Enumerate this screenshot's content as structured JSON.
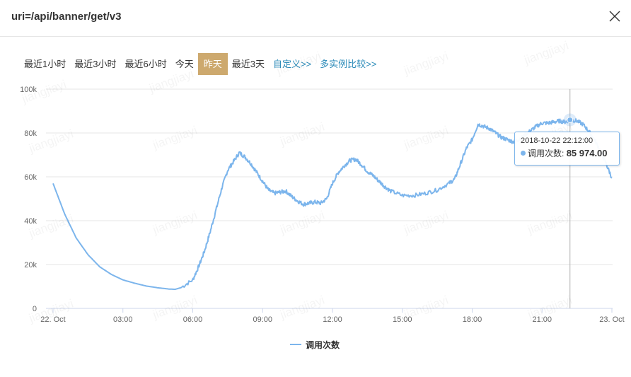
{
  "header": {
    "title": "uri=/api/banner/get/v3"
  },
  "toolbar": {
    "buttons": [
      "最近1小时",
      "最近3小时",
      "最近6小时",
      "今天",
      "昨天",
      "最近3天"
    ],
    "active_index": 4,
    "links": [
      "自定义>>",
      "多实例比较>>"
    ]
  },
  "watermark_text": "jiangjiayi",
  "colors": {
    "series": "#7cb5ec",
    "active_button": "#cda96e",
    "link": "#2a8ab8"
  },
  "tooltip": {
    "date": "2018-10-22 22:12:00",
    "label": "调用次数:",
    "value": "85 974.00"
  },
  "chart_data": {
    "type": "line",
    "xlabel": "",
    "ylabel": "",
    "ylim": [
      0,
      100000
    ],
    "y_ticks": [
      0,
      20000,
      40000,
      60000,
      80000,
      100000
    ],
    "y_tick_labels": [
      "0",
      "20k",
      "40k",
      "60k",
      "80k",
      "100k"
    ],
    "x_range_hours": [
      0,
      24
    ],
    "x_ticks_hours": [
      0,
      3,
      6,
      9,
      12,
      15,
      18,
      21,
      24
    ],
    "x_tick_labels": [
      "22. Oct",
      "03:00",
      "06:00",
      "09:00",
      "12:00",
      "15:00",
      "18:00",
      "21:00",
      "23. Oct"
    ],
    "legend_position": "bottom-center",
    "grid": true,
    "series": [
      {
        "name": "调用次数",
        "x_hours": [
          0.0,
          0.5,
          1.0,
          1.5,
          2.0,
          2.5,
          3.0,
          3.5,
          4.0,
          4.5,
          5.0,
          5.25,
          5.5,
          6.0,
          6.25,
          6.5,
          6.75,
          7.0,
          7.25,
          7.5,
          7.75,
          8.0,
          8.25,
          8.5,
          8.75,
          9.0,
          9.25,
          9.5,
          9.75,
          10.0,
          10.25,
          10.5,
          10.75,
          11.0,
          11.25,
          11.5,
          11.75,
          12.0,
          12.25,
          12.5,
          12.75,
          13.0,
          13.25,
          13.5,
          13.75,
          14.0,
          14.25,
          14.5,
          15.0,
          15.5,
          16.0,
          16.5,
          17.0,
          17.25,
          17.5,
          17.75,
          18.0,
          18.25,
          18.5,
          18.75,
          19.0,
          19.25,
          19.5,
          19.75,
          20.0,
          20.25,
          20.5,
          20.75,
          21.0,
          21.25,
          21.5,
          21.75,
          22.0,
          22.2,
          22.5,
          22.75,
          23.0,
          23.25,
          23.5,
          23.75,
          24.0
        ],
        "values": [
          57000,
          43000,
          32000,
          24500,
          19000,
          15500,
          13000,
          11500,
          10200,
          9400,
          8800,
          8700,
          9500,
          13000,
          19000,
          26000,
          35000,
          45000,
          55000,
          63000,
          67000,
          71000,
          69000,
          66000,
          62000,
          58000,
          54000,
          52500,
          53000,
          53500,
          51000,
          49000,
          47500,
          48000,
          48500,
          48000,
          50000,
          57000,
          62000,
          65000,
          67500,
          68000,
          65500,
          62500,
          60500,
          58000,
          55500,
          53500,
          51500,
          51500,
          52500,
          54000,
          57000,
          59000,
          66000,
          73000,
          77000,
          84000,
          83000,
          82000,
          80000,
          78000,
          77000,
          76000,
          77000,
          79000,
          81000,
          83000,
          84500,
          84500,
          85000,
          85500,
          85000,
          85974,
          85500,
          84000,
          81000,
          77000,
          72000,
          66000,
          59500
        ]
      }
    ]
  }
}
